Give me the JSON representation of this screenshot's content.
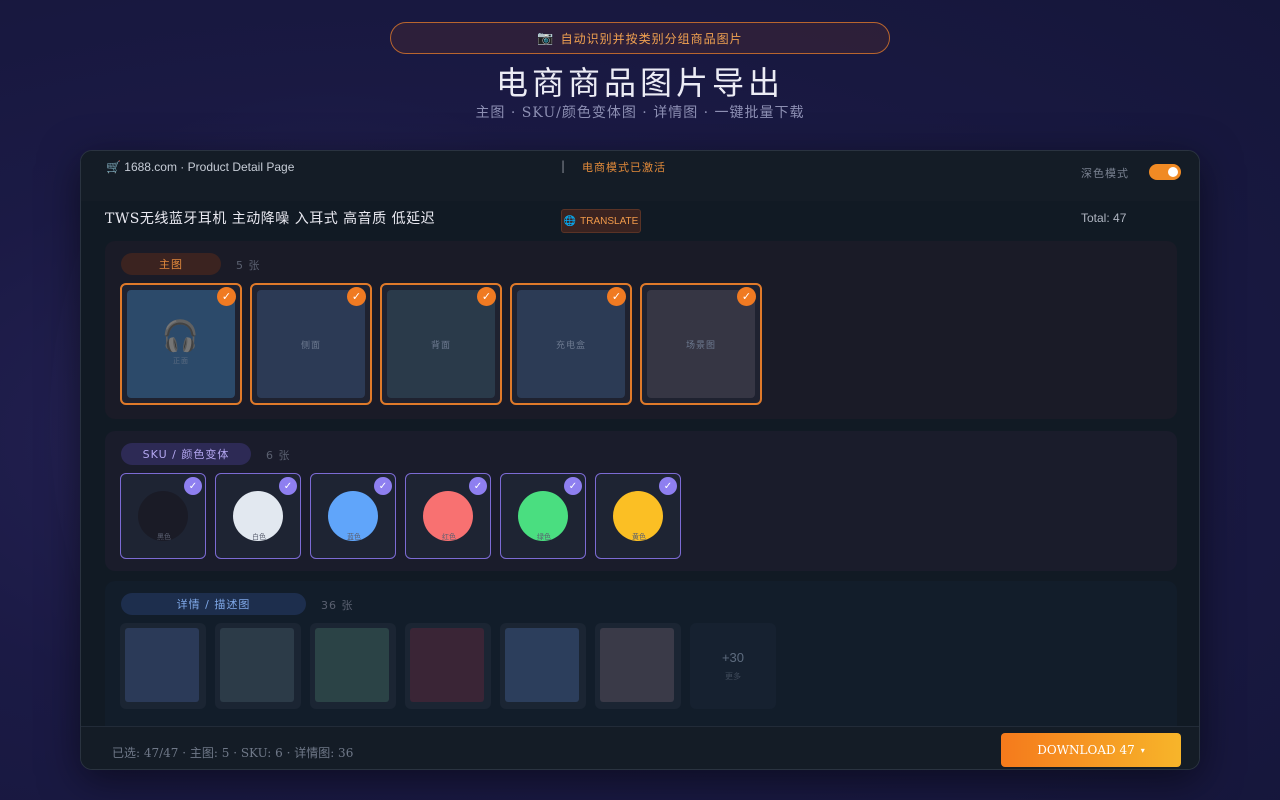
{
  "banner": {
    "icon": "camera-icon",
    "icon_glyph": "📷",
    "text": "自动识别并按类别分组商品图片"
  },
  "hero": {
    "title": "电商商品图片导出",
    "subtitle": "主图 · SKU/颜色变体图 · 详情图 · 一键批量下载"
  },
  "topbar": {
    "site": "🛒 1688.com · Product Detail Page",
    "separator": "|",
    "mode_status": "电商模式已激活",
    "dark_mode_label": "深色模式",
    "dark_mode_on": true
  },
  "product": {
    "title": "TWS无线蓝牙耳机 主动降噪 入耳式 高音质 低延迟",
    "translate_label": "TRANSLATE",
    "translate_icon": "🌐",
    "total": "Total: 47"
  },
  "main_images": {
    "label": "主图",
    "count": "5 张",
    "items": [
      {
        "label": "正面",
        "icon": "headphones-icon",
        "glyph": "🎧",
        "color": "#2c4a6a",
        "checked": true
      },
      {
        "label": "侧面",
        "color": "#2c3a55",
        "checked": true
      },
      {
        "label": "背面",
        "color": "#2a3a4a",
        "checked": true
      },
      {
        "label": "充电盒",
        "color": "#2c3b55",
        "checked": true
      },
      {
        "label": "场景图",
        "color": "#363644",
        "checked": true
      }
    ]
  },
  "sku_images": {
    "label": "SKU / 颜色变体",
    "count": "6 张",
    "items": [
      {
        "label": "黑色",
        "color": "#1a1b26",
        "checked": true
      },
      {
        "label": "白色",
        "color": "#e2e8f0",
        "checked": true
      },
      {
        "label": "蓝色",
        "color": "#60a5fa",
        "checked": true
      },
      {
        "label": "红色",
        "color": "#f87171",
        "checked": true
      },
      {
        "label": "绿色",
        "color": "#4ade80",
        "checked": true
      },
      {
        "label": "黄色",
        "color": "#fbbf24",
        "checked": true
      }
    ]
  },
  "detail_images": {
    "label": "详情 / 描述图",
    "count": "36 张",
    "items": [
      {
        "color": "#2b3a58"
      },
      {
        "color": "#2c3b48"
      },
      {
        "color": "#2b4346"
      },
      {
        "color": "#3a2536"
      },
      {
        "color": "#2c3e5c"
      },
      {
        "color": "#3a3a48"
      }
    ],
    "more_count": "+30",
    "more_label": "更多"
  },
  "footer": {
    "stats": "已选: 47/47 · 主图: 5 · SKU: 6 · 详情图: 36",
    "download_label": "DOWNLOAD 47",
    "download_caret": "▾"
  },
  "check_glyph": "✓"
}
